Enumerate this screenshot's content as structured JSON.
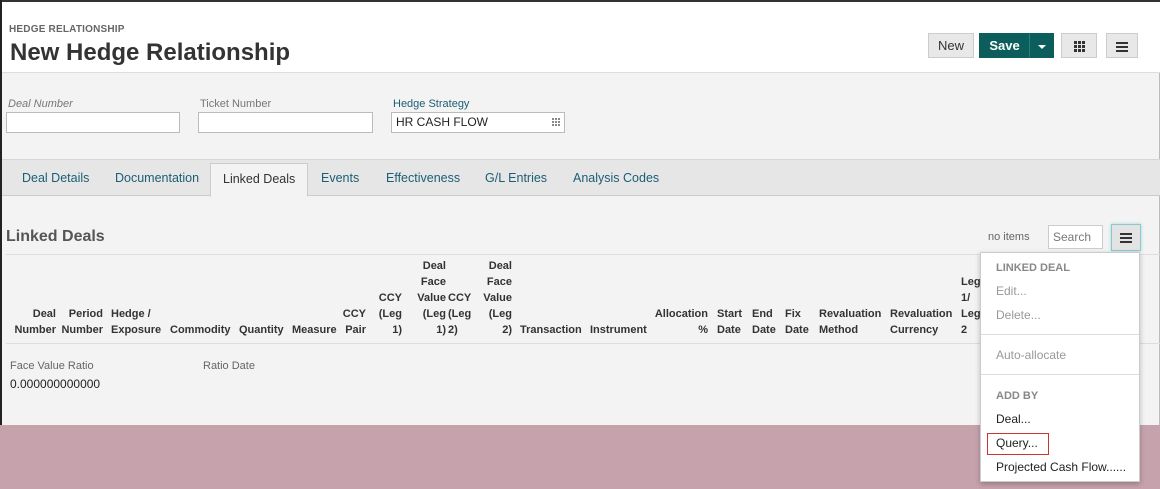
{
  "header": {
    "breadcrumb": "HEDGE RELATIONSHIP",
    "title": "New Hedge Relationship",
    "new_label": "New",
    "save_label": "Save"
  },
  "fields": {
    "deal_number": {
      "label": "Deal Number",
      "value": ""
    },
    "ticket_number": {
      "label": "Ticket Number",
      "value": ""
    },
    "hedge_strategy": {
      "label": "Hedge Strategy",
      "value": "HR CASH FLOW"
    }
  },
  "tabs": [
    {
      "label": "Deal Details"
    },
    {
      "label": "Documentation"
    },
    {
      "label": "Linked Deals"
    },
    {
      "label": "Events"
    },
    {
      "label": "Effectiveness"
    },
    {
      "label": "G/L Entries"
    },
    {
      "label": "Analysis Codes"
    }
  ],
  "active_tab": "Linked Deals",
  "linked_deals": {
    "title": "Linked Deals",
    "count_text": "no items",
    "search_placeholder": "Search",
    "columns": [
      {
        "lines": [
          "Deal",
          "Number"
        ]
      },
      {
        "lines": [
          "Period",
          "Number"
        ]
      },
      {
        "lines": [
          "Hedge /",
          "Exposure"
        ]
      },
      {
        "lines": [
          "Commodity"
        ]
      },
      {
        "lines": [
          "Quantity"
        ]
      },
      {
        "lines": [
          "Measure"
        ]
      },
      {
        "lines": [
          "CCY",
          "Pair"
        ]
      },
      {
        "lines": [
          "CCY",
          "(Leg",
          "1)"
        ]
      },
      {
        "lines": [
          "Deal",
          "Face",
          "Value",
          "(Leg",
          "1)"
        ]
      },
      {
        "lines": [
          "CCY",
          "(Leg",
          "2)"
        ]
      },
      {
        "lines": [
          "Deal",
          "Face",
          "Value",
          "(Leg",
          "2)"
        ]
      },
      {
        "lines": [
          "Transaction"
        ]
      },
      {
        "lines": [
          "Instrument"
        ]
      },
      {
        "lines": [
          "Allocation",
          "%"
        ]
      },
      {
        "lines": [
          "Start",
          "Date"
        ]
      },
      {
        "lines": [
          "End",
          "Date"
        ]
      },
      {
        "lines": [
          "Fix",
          "Date"
        ]
      },
      {
        "lines": [
          "Revaluation",
          "Method"
        ]
      },
      {
        "lines": [
          "Revaluation",
          "Currency"
        ]
      },
      {
        "lines": [
          "Leg",
          "1/",
          "Leg",
          "2"
        ]
      }
    ],
    "face_value_ratio_label": "Face Value Ratio",
    "face_value_ratio_value": "0.000000000000",
    "ratio_date_label": "Ratio Date"
  },
  "menu": {
    "linked_deal_header": "LINKED DEAL",
    "edit": "Edit...",
    "delete": "Delete...",
    "auto_allocate": "Auto-allocate",
    "add_by_header": "ADD BY",
    "deal": "Deal...",
    "query": "Query...",
    "projected": "Projected Cash Flow......"
  },
  "colors": {
    "save_button": "#0b5e5c",
    "link_teal": "#1b5e74",
    "background_outside": "#c6a2ad"
  }
}
